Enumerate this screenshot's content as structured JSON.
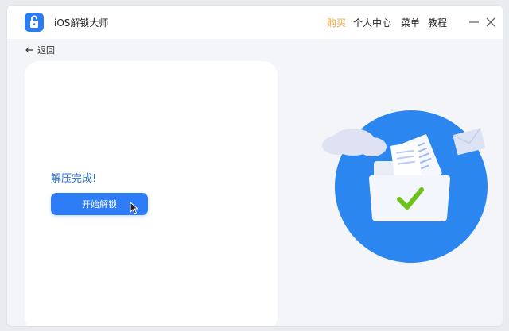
{
  "app": {
    "title": "iOS解锁大师",
    "accent": "#2c7cf6"
  },
  "nav": {
    "buy": "购买",
    "personal_center": "个人中心",
    "menu": "菜单",
    "tutorial": "教程"
  },
  "back": {
    "label": "返回"
  },
  "main": {
    "status": "解压完成!",
    "start_button": "开始解锁"
  },
  "colors": {
    "buy": "#f0a43a",
    "primary": "#2e7cf6",
    "status": "#2a6fd6",
    "check": "#6cc41a"
  },
  "icons": [
    "lock-icon",
    "minimize-icon",
    "close-icon",
    "arrow-left-icon",
    "cursor-icon",
    "folder-illustration",
    "checkmark-icon",
    "cloud-icon",
    "document-icon",
    "envelope-icon"
  ]
}
